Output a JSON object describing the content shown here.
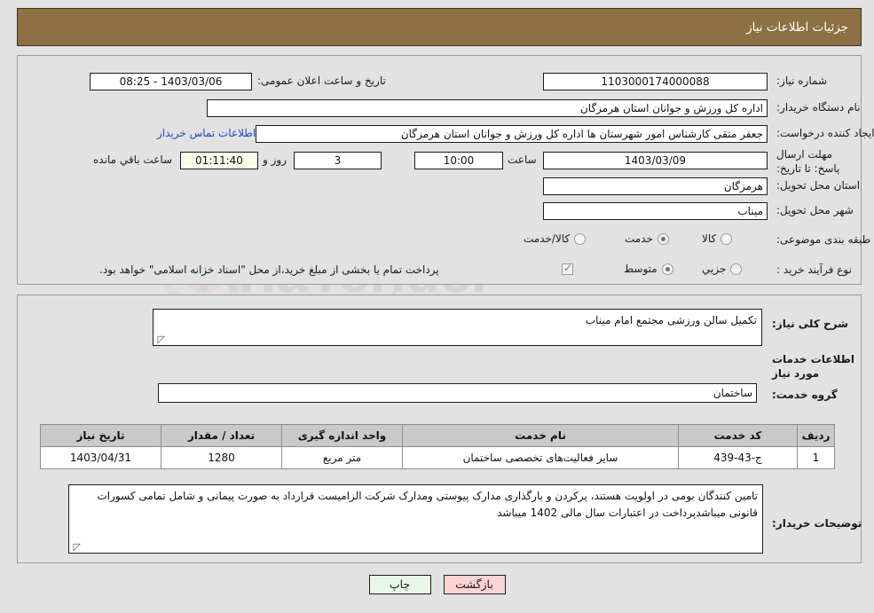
{
  "header": {
    "title": "جزئیات اطلاعات نیاز"
  },
  "top_section": {
    "need_number_label": "شماره نیاز:",
    "need_number_value": "1103000174000088",
    "public_announce_label": "تاریخ و ساعت اعلان عمومی:",
    "public_announce_value": "1403/03/06 - 08:25",
    "buyer_org_label": "نام دستگاه خریدار:",
    "buyer_org_value": "اداره کل ورزش و جوانان استان هرمزگان",
    "creator_label": "ایجاد کننده درخواست:",
    "creator_value": "جعفر متقی کارشناس امور شهرستان ها اداره کل ورزش و جوانان استان هرمزگان",
    "contact_link": "اطلاعات تماس خریدار",
    "deadline_label": "مهلت ارسال پاسخ: تا تاریخ:",
    "deadline_date": "1403/03/09",
    "hour_label": "ساعت",
    "hour_value": "10:00",
    "days_value": "3",
    "days_label": "روز و",
    "countdown_value": "01:11:40",
    "remaining_label": "ساعت باقي مانده",
    "province_label": "استان محل تحویل:",
    "province_value": "هرمزگان",
    "city_label": "شهر محل تحویل:",
    "city_value": "میناب",
    "category_label": "طبقه بندی موضوعی:",
    "category_options": [
      {
        "label": "کالا",
        "selected": false
      },
      {
        "label": "خدمت",
        "selected": true
      },
      {
        "label": "کالا/خدمت",
        "selected": false
      }
    ],
    "process_label": "نوع فرآیند خرید :",
    "process_options": [
      {
        "label": "جزیي",
        "selected": false
      },
      {
        "label": "متوسط",
        "selected": true
      }
    ],
    "treasury_checked": true,
    "treasury_note": "پرداخت تمام یا بخشی از مبلغ خرید،از محل \"اسناد خزانه اسلامی\" خواهد بود."
  },
  "mid_section": {
    "general_desc_label": "شرح کلی نیاز:",
    "general_desc_value": "تکمیل سالن ورزشی مجتمع امام میناب",
    "services_info_title": "اطلاعات خدمات مورد نیاز",
    "service_group_label": "گروه خدمت:",
    "service_group_value": "ساختمان",
    "table": {
      "columns": [
        "ردیف",
        "کد خدمت",
        "نام خدمت",
        "واحد اندازه گیری",
        "تعداد / مقدار",
        "تاریخ نیاز"
      ],
      "rows": [
        {
          "row_no": "1",
          "service_code": "ج-43-439",
          "service_name": "سایر فعالیت‌های تخصصی ساختمان",
          "unit": "متر مربع",
          "quantity": "1280",
          "need_date": "1403/04/31"
        }
      ]
    },
    "buyer_notes_label": "توضیحات خریدار:",
    "buyer_notes_value": "تامین کنندگان بومی در اولویت هستند، پرکردن و بارگذاری مدارک پیوستی ومدارک شرکت الزامیست   قرارداد به صورت پیمانی و شامل تمامی کسورات قانونی میباشدپرداخت در اعتبارات سال مالی 1402 میباشد"
  },
  "footer": {
    "print_label": "چاپ",
    "back_label": "بازگشت"
  },
  "colors": {
    "header_bar": "#8d7142",
    "page_background": "#e2e2e2",
    "table_header": "#c9c9c9",
    "link": "#1c4bbd",
    "countdown_field": "#fbfbe8",
    "print_button": "#e8f8e8",
    "back_button": "#fbd3d3"
  }
}
